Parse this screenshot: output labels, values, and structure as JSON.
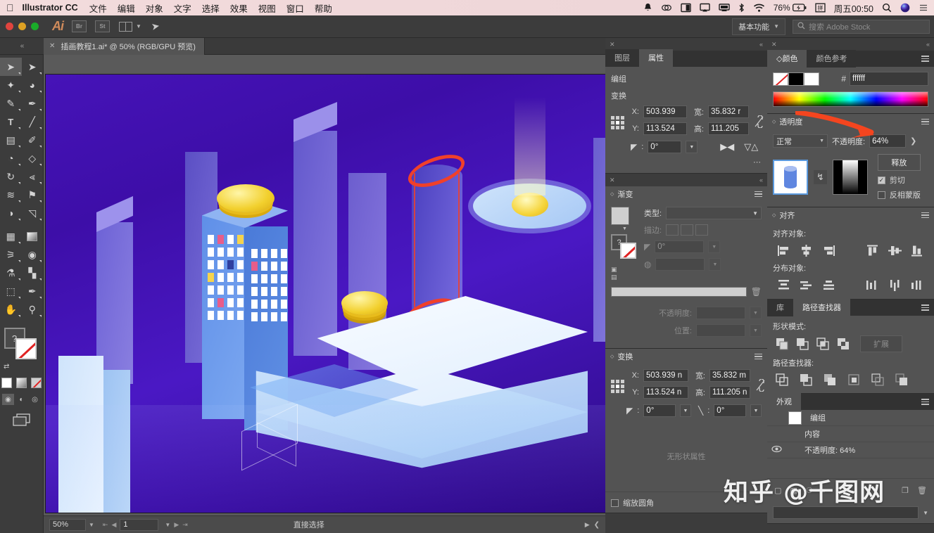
{
  "macbar": {
    "apple_icon": "apple-icon",
    "app_name": "Illustrator CC",
    "menus": [
      "文件",
      "编辑",
      "对象",
      "文字",
      "选择",
      "效果",
      "视图",
      "窗口",
      "帮助"
    ],
    "status_icons": [
      "bell-icon",
      "creative-cloud-icon",
      "display-icon",
      "airplay-icon",
      "screen-share-icon",
      "bluetooth-icon",
      "wifi-icon"
    ],
    "battery": "76%",
    "battery_icon": "battery-charging-icon",
    "input_source_icon": "input-method-icon",
    "clock": "周五00:50",
    "search_icon": "spotlight-search-icon",
    "siri_icon": "siri-icon",
    "controlcenter_icon": "notification-center-icon"
  },
  "apptop": {
    "logo": "Ai",
    "bridge_label": "Br",
    "stock_label": "St",
    "arrange_icon": "arrange-documents-icon",
    "chevron_icon": "chevron-down-icon",
    "rocket_icon": "rocket-icon",
    "workspace": "基本功能",
    "workspace_chevron": "chevron-down-icon",
    "search_icon": "search-icon",
    "search_placeholder": "搜索 Adobe Stock"
  },
  "tabbar": {
    "collapse_icon": "collapse-panel-icon",
    "close_icon": "close-icon",
    "doc_title": "插画教程1.ai* @ 50% (RGB/GPU 预览)"
  },
  "toolbar": {
    "tools": [
      {
        "name": "selection-tool",
        "glyph": "➤",
        "selected": true
      },
      {
        "name": "direct-selection-tool",
        "glyph": "➤",
        "selected": false
      },
      {
        "name": "magic-wand-tool",
        "glyph": "✦",
        "selected": false
      },
      {
        "name": "lasso-tool",
        "glyph": "☁",
        "selected": false
      },
      {
        "name": "pen-tool",
        "glyph": "✒",
        "selected": false
      },
      {
        "name": "curvature-tool",
        "glyph": "✎",
        "selected": false
      },
      {
        "name": "type-tool",
        "glyph": "T",
        "selected": false
      },
      {
        "name": "line-segment-tool",
        "glyph": "╱",
        "selected": false
      },
      {
        "name": "rectangle-tool",
        "glyph": "□",
        "selected": false
      },
      {
        "name": "paintbrush-tool",
        "glyph": "✐",
        "selected": false
      },
      {
        "name": "shaper-tool",
        "glyph": "◔",
        "selected": false
      },
      {
        "name": "eraser-tool",
        "glyph": "◇",
        "selected": false
      },
      {
        "name": "rotate-tool",
        "glyph": "↺",
        "selected": false
      },
      {
        "name": "scale-tool",
        "glyph": "⤡",
        "selected": false
      },
      {
        "name": "width-tool",
        "glyph": "≋",
        "selected": false
      },
      {
        "name": "free-transform-tool",
        "glyph": "⚑",
        "selected": false
      },
      {
        "name": "shape-builder-tool",
        "glyph": "◑",
        "selected": false
      },
      {
        "name": "perspective-grid-tool",
        "glyph": "◱",
        "selected": false
      },
      {
        "name": "mesh-tool",
        "glyph": "▒",
        "selected": false
      },
      {
        "name": "gradient-tool",
        "glyph": "▣",
        "selected": false
      },
      {
        "name": "eyedropper-tool",
        "glyph": "⚗",
        "selected": false
      },
      {
        "name": "blend-tool",
        "glyph": "◎",
        "selected": false
      },
      {
        "name": "symbol-sprayer-tool",
        "glyph": "⁂",
        "selected": false
      },
      {
        "name": "column-graph-tool",
        "glyph": "█",
        "selected": false
      },
      {
        "name": "artboard-tool",
        "glyph": "⬚",
        "selected": false
      },
      {
        "name": "slice-tool",
        "glyph": "✂",
        "selected": false
      },
      {
        "name": "hand-tool",
        "glyph": "✋",
        "selected": false
      },
      {
        "name": "zoom-tool",
        "glyph": "⚲",
        "selected": false
      }
    ],
    "fill_label": "?",
    "swatches": [
      "color-swatch",
      "gradient-swatch",
      "none-swatch"
    ],
    "draw_modes": [
      "draw-normal",
      "draw-behind",
      "draw-inside"
    ],
    "screen_mode_icon": "change-screen-mode-icon"
  },
  "statusbar": {
    "zoom": "50%",
    "zoom_chevron": "chevron-down-icon",
    "first_icon": "first-artboard-icon",
    "prev_icon": "prev-artboard-icon",
    "page": "1",
    "page_chevron": "chevron-down-icon",
    "next_icon": "next-artboard-icon",
    "last_icon": "last-artboard-icon",
    "current_tool": "直接选择",
    "play_icon": "play-icon",
    "resize_icon": "resize-grip-icon"
  },
  "properties_panel": {
    "close_icon": "close-icon",
    "collapse_icon": "collapse-icon",
    "tabs": [
      {
        "label": "图层",
        "active": false
      },
      {
        "label": "属性",
        "active": true
      }
    ],
    "selection_label": "编组",
    "transform_label": "变换",
    "x_label": "X:",
    "x_value": "503.939",
    "y_label": "Y:",
    "y_value": "113.524",
    "w_label": "宽:",
    "w_value": "35.832 r",
    "h_label": "高:",
    "h_value": "111.205",
    "angle_label": "angle-icon",
    "angle_value": "0°",
    "link_icon": "constrain-proportions-unlinked-icon",
    "flip_h_icon": "flip-horizontal-icon",
    "flip_v_icon": "flip-vertical-icon",
    "more_icon": "more-options-icon"
  },
  "gradient_panel": {
    "close_icon": "close-icon",
    "collapse_icon": "collapse-icon",
    "title": "渐变",
    "menu_icon": "panel-menu-icon",
    "swatch_name": "gradient-swatch",
    "type_label": "类型:",
    "type_value": "",
    "stroke_label": "描边:",
    "stroke_icons": [
      "stroke-within-icon",
      "stroke-along-icon",
      "stroke-across-icon"
    ],
    "angle_value": "0°",
    "aspect_value": "",
    "opacity_label": "不透明度:",
    "opacity_value": "",
    "position_label": "位置:",
    "position_value": "",
    "delete_icon": "delete-stop-icon",
    "fill_stroke_icon": "fill-stroke-indicator"
  },
  "transform_panel": {
    "close_icon": "close-icon",
    "title": "变换",
    "menu_icon": "panel-menu-icon",
    "x_label": "X:",
    "x_value": "503.939 n",
    "y_label": "Y:",
    "y_value": "113.524 n",
    "w_label": "宽:",
    "w_value": "35.832 m",
    "h_label": "高:",
    "h_value": "111.205 n",
    "angle_value": "0°",
    "shear_value": "0°",
    "link_icon": "constrain-proportions-unlinked-icon",
    "no_shape_text": "无形状属性",
    "scale_corners_label": "缩放圆角",
    "scale_corners_checked": false
  },
  "color_panel": {
    "close_icon": "close-icon",
    "collapse_icon": "collapse-icon",
    "tabs": [
      {
        "label": "颜色",
        "active": true
      },
      {
        "label": "颜色参考",
        "active": false
      }
    ],
    "menu_icon": "panel-menu-icon",
    "hash_label": "#",
    "hex_value": "ffffff",
    "swatch_none": "none-color-swatch",
    "swatch_black": "black-swatch",
    "swatch_white": "white-swatch",
    "spectrum_name": "color-spectrum-ramp"
  },
  "transparency_panel": {
    "title": "透明度",
    "menu_icon": "panel-menu-icon",
    "blend_mode": "正常",
    "blend_chevron": "chevron-down-icon",
    "opacity_label": "不透明度:",
    "opacity_value": "64%",
    "opacity_chevron": "expand-options-icon",
    "art_thumb": "artwork-thumbnail",
    "link_icon": "link-mask-icon",
    "mask_thumb": "opacity-mask-thumbnail",
    "release_button": "释放",
    "clip_label": "剪切",
    "clip_checked": true,
    "invert_label": "反相蒙版",
    "invert_checked": false
  },
  "align_panel": {
    "title": "对齐",
    "menu_icon": "panel-menu-icon",
    "align_objects_label": "对齐对象:",
    "align_icons": [
      "align-left-icon",
      "align-horizontal-center-icon",
      "align-right-icon",
      "align-top-icon",
      "align-vertical-center-icon",
      "align-bottom-icon"
    ],
    "distribute_objects_label": "分布对象:",
    "distribute_icons": [
      "distribute-top-icon",
      "distribute-vertical-center-icon",
      "distribute-bottom-icon",
      "distribute-left-icon",
      "distribute-horizontal-center-icon",
      "distribute-right-icon"
    ]
  },
  "pathfinder_panel": {
    "tabs": [
      {
        "label": "库",
        "active": false
      },
      {
        "label": "路径查找器",
        "active": true
      }
    ],
    "menu_icon": "panel-menu-icon",
    "shape_modes_label": "形状模式:",
    "shape_mode_icons": [
      "unite-icon",
      "minus-front-icon",
      "intersect-icon",
      "exclude-icon"
    ],
    "expand_button": "扩展",
    "pathfinders_label": "路径查找器:",
    "pathfinder_icons": [
      "divide-icon",
      "trim-icon",
      "merge-icon",
      "crop-icon",
      "outline-icon",
      "minus-back-icon"
    ]
  },
  "appearance_panel": {
    "tabs": [
      {
        "label": "外观",
        "active": true
      }
    ],
    "menu_icon": "panel-menu-icon",
    "rows": [
      {
        "name": "group-row",
        "label": "编组",
        "has_swatch": true,
        "has_eye": false
      },
      {
        "name": "contents-row",
        "label": "内容",
        "has_swatch": false,
        "has_eye": false
      },
      {
        "name": "opacity-row",
        "label": "不透明度: 64%",
        "has_swatch": false,
        "has_eye": true
      }
    ],
    "footer_icons": [
      "add-stroke-icon",
      "add-fill-icon",
      "add-effect-icon",
      "clear-appearance-icon",
      "duplicate-item-icon",
      "delete-item-icon"
    ]
  },
  "canvas": {
    "artboard_name": "isometric-city-illustration",
    "annotation_name": "red-highlight-annotation",
    "background_gradient": "#4613b8"
  },
  "watermark": {
    "text": "知乎 @千图网"
  },
  "accent": {
    "red_annotation": "#f0402a",
    "selection_blue": "#5b9ade",
    "panel_bg": "#535353",
    "app_bg": "#3c3c3c"
  }
}
